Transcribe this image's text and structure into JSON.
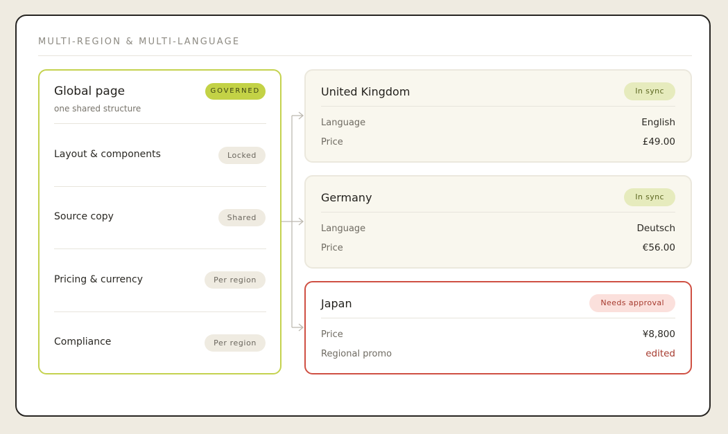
{
  "section_title": "MULTI-REGION & MULTI-LANGUAGE",
  "global": {
    "title": "Global page",
    "subtitle": "one shared structure",
    "badge": "GOVERNED",
    "rows": [
      {
        "label": "Layout & components",
        "status": "Locked"
      },
      {
        "label": "Source copy",
        "status": "Shared"
      },
      {
        "label": "Pricing & currency",
        "status": "Per region"
      },
      {
        "label": "Compliance",
        "status": "Per region"
      }
    ]
  },
  "regions": [
    {
      "name": "United Kingdom",
      "status": "In sync",
      "rows": [
        {
          "label": "Language",
          "value": "English"
        },
        {
          "label": "Price",
          "value": "£49.00"
        }
      ]
    },
    {
      "name": "Germany",
      "status": "In sync",
      "rows": [
        {
          "label": "Language",
          "value": "Deutsch"
        },
        {
          "label": "Price",
          "value": "€56.00"
        }
      ]
    },
    {
      "name": "Japan",
      "status": "Needs approval",
      "rows": [
        {
          "label": "Price",
          "value": "¥8,800"
        },
        {
          "label": "Regional promo",
          "value": "edited"
        }
      ]
    }
  ],
  "colors": {
    "governed_accent": "#c3d246",
    "alert_border": "#cf4f42",
    "sync_badge": "#e6ebbd",
    "alert_badge": "#fbe0dc"
  }
}
